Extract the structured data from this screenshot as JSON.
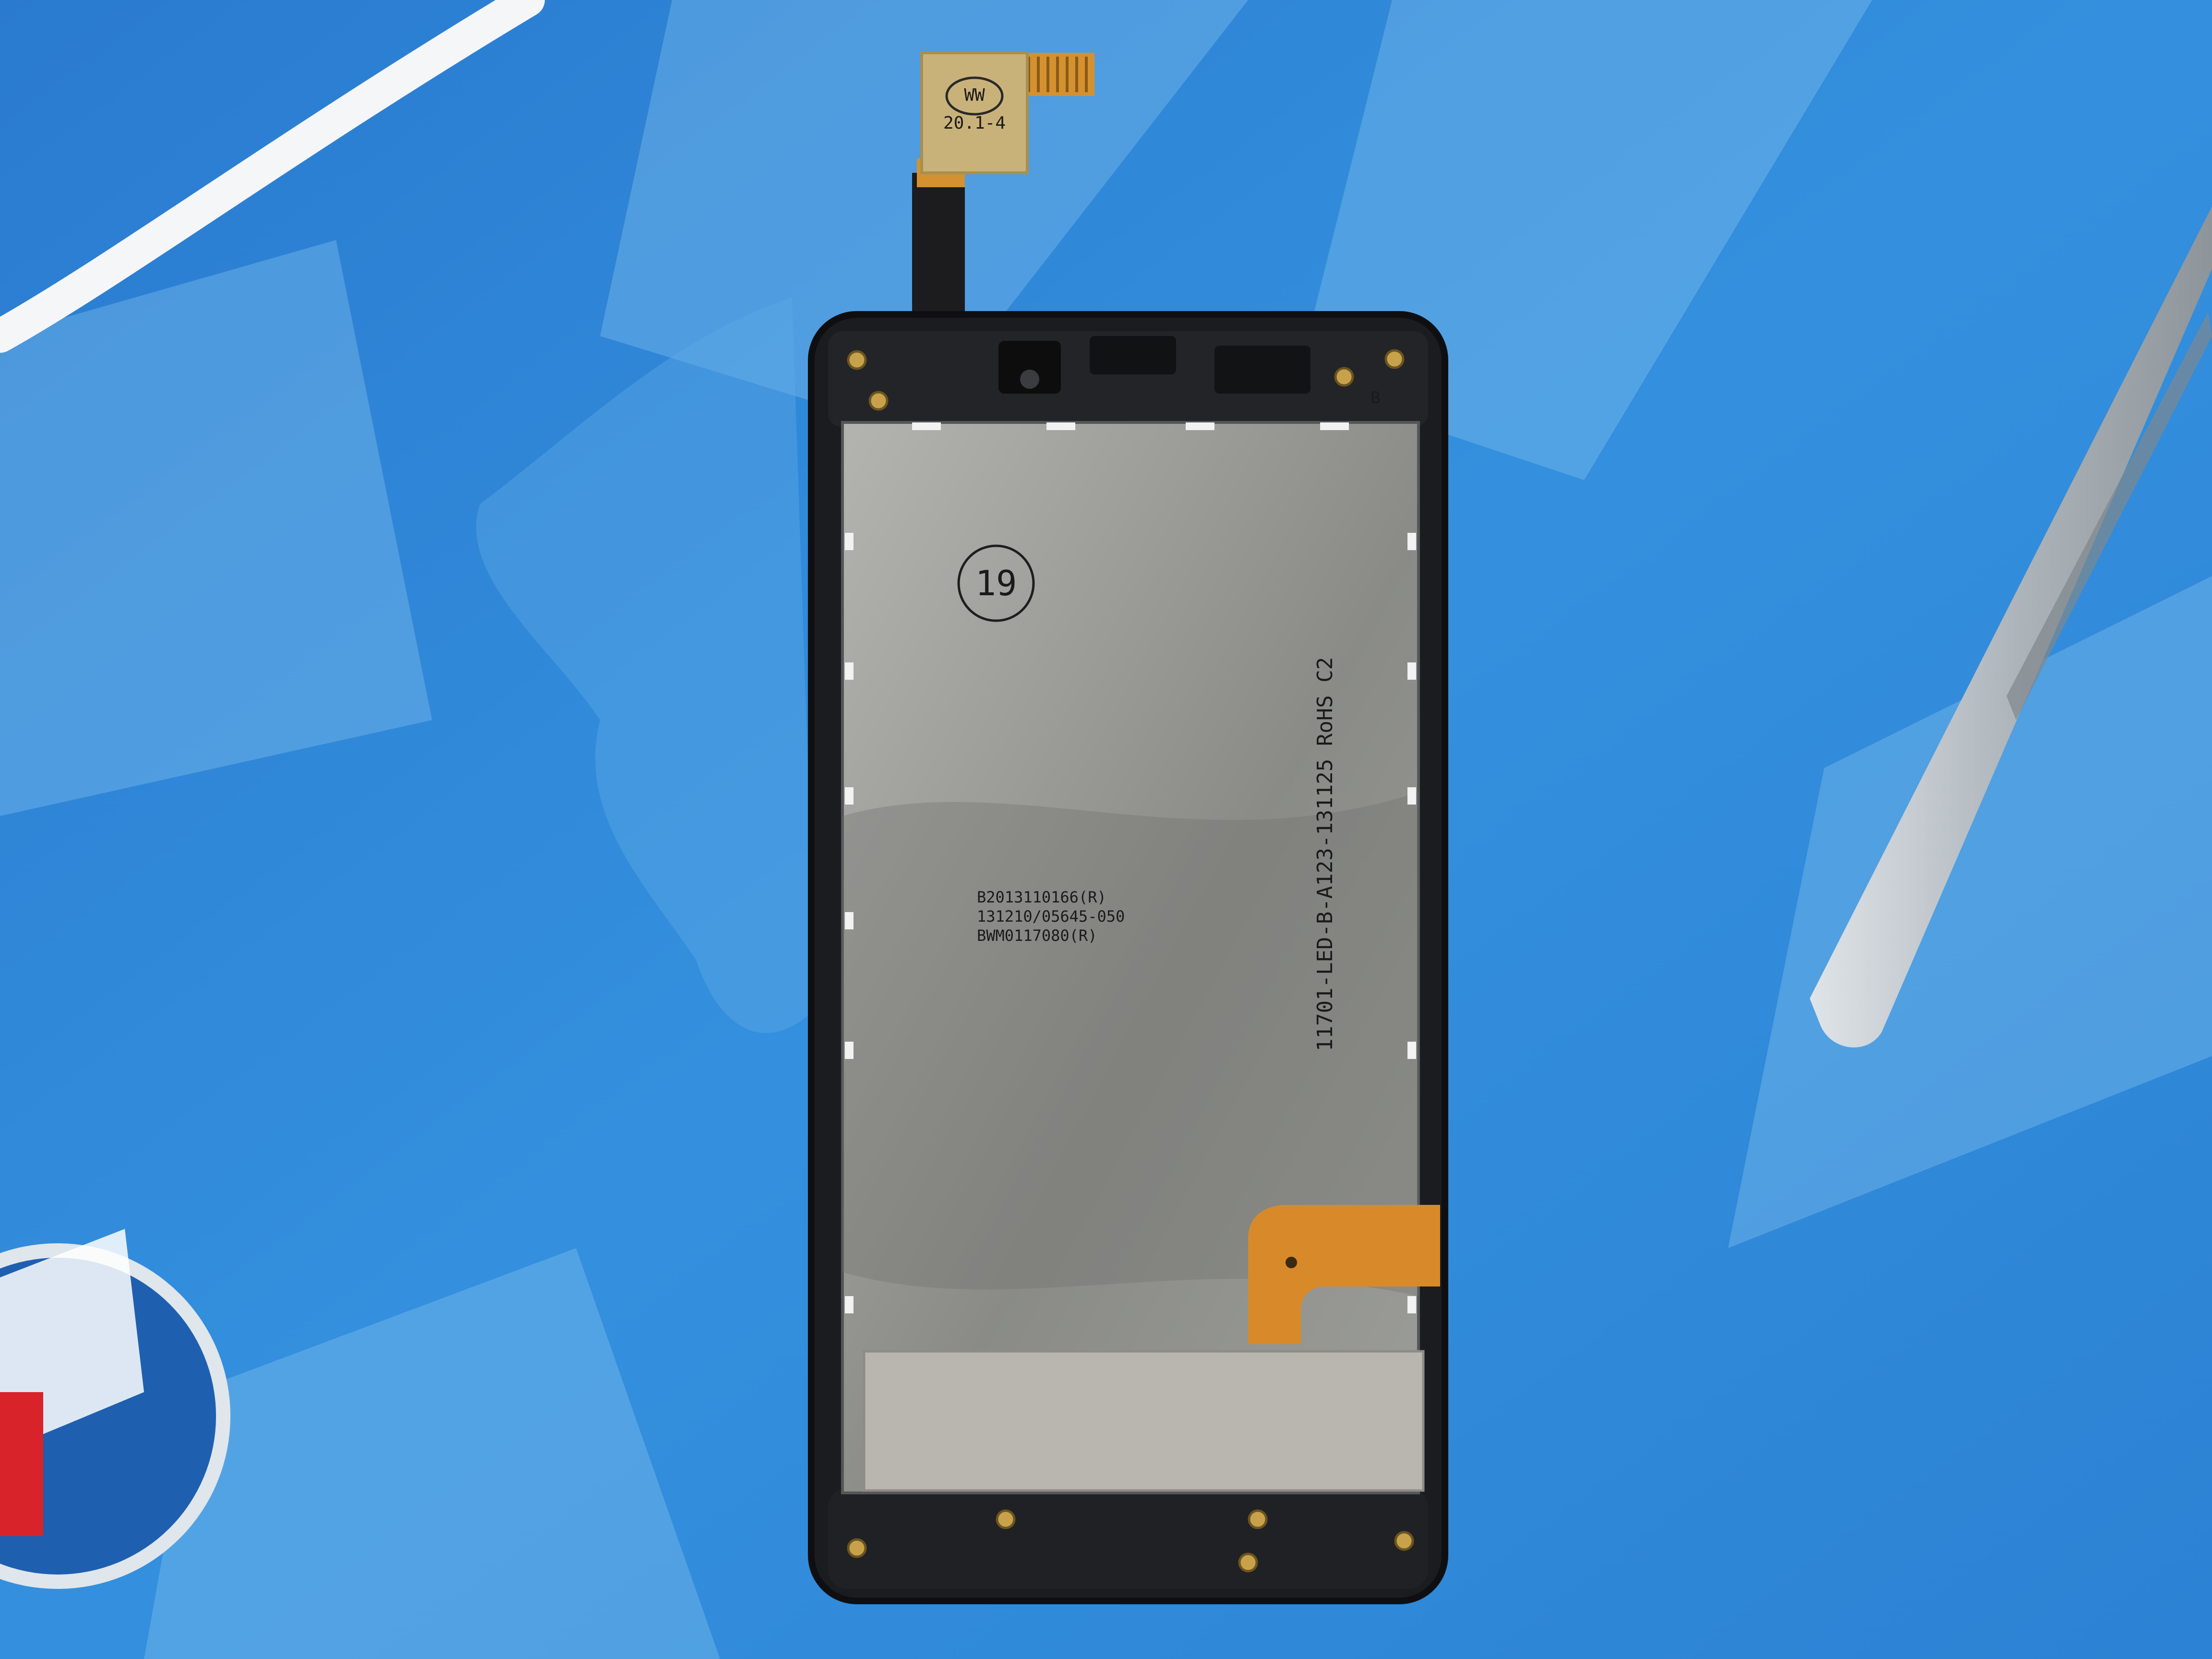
{
  "scene": {
    "subject": "phone-display-assembly-back",
    "colors": {
      "mat": "#2f86d8",
      "mat_light": "#7fc0ec",
      "frame": "#1b1c1f",
      "panel": "#a9aaa6",
      "panel_dark": "#6f706c",
      "flex": "#d88a2a",
      "label": "#c9b27a",
      "tape": "#b8b6ae",
      "tweezers": "#b9c0c6",
      "screw": "#c8a24a"
    }
  },
  "labels": {
    "sticker_line1": "WW",
    "sticker_line2": "20.1-4",
    "stamp": "19",
    "vertical": "11701-LED-B-A123-131125 RoHS C2",
    "block_line1": "B2013110166(R)",
    "block_line2": "131210/05645-050",
    "block_line3": "BWM0117080(R)",
    "frame_mark": "B"
  }
}
